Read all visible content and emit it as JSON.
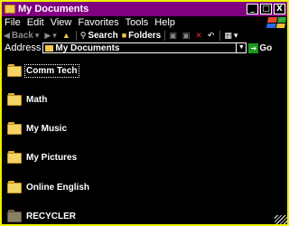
{
  "window": {
    "title": "My Documents"
  },
  "controls": {
    "minimize": "_",
    "maximize": "□",
    "close": "X"
  },
  "menu": [
    "File",
    "Edit",
    "View",
    "Favorites",
    "Tools",
    "Help"
  ],
  "toolbar": {
    "back": "Back",
    "search": "Search",
    "folders": "Folders"
  },
  "address": {
    "label": "Address",
    "value": "My Documents",
    "go": "Go"
  },
  "folders": [
    {
      "name": "Comm Tech",
      "selected": true
    },
    {
      "name": "Math"
    },
    {
      "name": "My Music"
    },
    {
      "name": "My Pictures"
    },
    {
      "name": "Online English"
    },
    {
      "name": "RECYCLER",
      "icon": "dark"
    }
  ],
  "colors": {
    "window_border": "#f0f000",
    "titlebar": "#800080",
    "background": "#000000",
    "text": "#ffffff",
    "folder": "#f4d264"
  }
}
